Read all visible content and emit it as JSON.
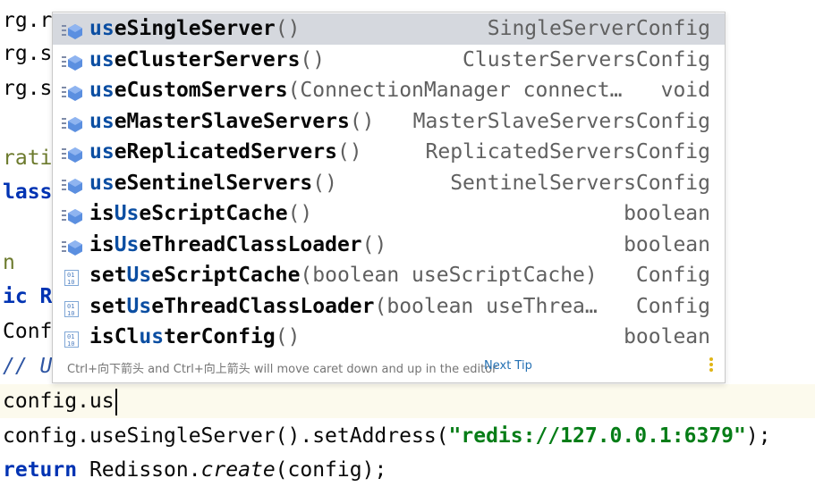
{
  "editor": {
    "background_lines": [
      "rg.r",
      "rg.s",
      "rg.s",
      "rati",
      "lass",
      "n",
      "ic R",
      "Conf",
      "// U"
    ],
    "current_line": "config.us",
    "line_next": {
      "a": "config.",
      "b": "useSingleServer",
      "c": "().setAddress(",
      "d": "\"redis://127.0.0.1:6379\"",
      "e": ");"
    },
    "line_return": {
      "kw": "return",
      "a": " Redisson.",
      "b": "create",
      "c": "(config);"
    }
  },
  "popup": {
    "items": [
      {
        "icon": "method-icon",
        "prefix": "",
        "match": "us",
        "rest": "eSingleServer",
        "params": "()",
        "type": "SingleServerConfig",
        "selected": true
      },
      {
        "icon": "method-icon",
        "prefix": "",
        "match": "us",
        "rest": "eClusterServers",
        "params": "()",
        "type": "ClusterServersConfig"
      },
      {
        "icon": "method-icon",
        "prefix": "",
        "match": "us",
        "rest": "eCustomServers",
        "params": "(ConnectionManager connect…",
        "type": "void"
      },
      {
        "icon": "method-icon",
        "prefix": "",
        "match": "us",
        "rest": "eMasterSlaveServers",
        "params": "()",
        "type": "MasterSlaveServersConfig"
      },
      {
        "icon": "method-icon",
        "prefix": "",
        "match": "us",
        "rest": "eReplicatedServers",
        "params": "()",
        "type": "ReplicatedServersConfig"
      },
      {
        "icon": "method-icon",
        "prefix": "",
        "match": "us",
        "rest": "eSentinelServers",
        "params": "()",
        "type": "SentinelServersConfig"
      },
      {
        "icon": "method-icon",
        "prefix": "is",
        "match": "Us",
        "rest": "eScriptCache",
        "params": "()",
        "type": "boolean"
      },
      {
        "icon": "method-icon",
        "prefix": "is",
        "match": "Us",
        "rest": "eThreadClassLoader",
        "params": "()",
        "type": "boolean"
      },
      {
        "icon": "binary-icon",
        "prefix": "set",
        "match": "Us",
        "rest": "eScriptCache",
        "params": "(boolean useScriptCache)",
        "type": "Config"
      },
      {
        "icon": "binary-icon",
        "prefix": "set",
        "match": "Us",
        "rest": "eThreadClassLoader",
        "params": "(boolean useThrea…",
        "type": "Config"
      },
      {
        "icon": "binary-icon",
        "prefix": "isCl",
        "match": "us",
        "rest": "terConfig",
        "params": "()",
        "type": "boolean"
      }
    ],
    "footer": {
      "hint": "Ctrl+向下箭头 and Ctrl+向上箭头 will move caret down and up in the editor",
      "tip": "Next Tip"
    }
  },
  "colors": {
    "keyword": "#0033b3",
    "string": "#067d17",
    "match": "#0b4ea2",
    "selected_row": "#d5d8de",
    "current_line": "#fcfaed",
    "link": "#2470b3"
  }
}
